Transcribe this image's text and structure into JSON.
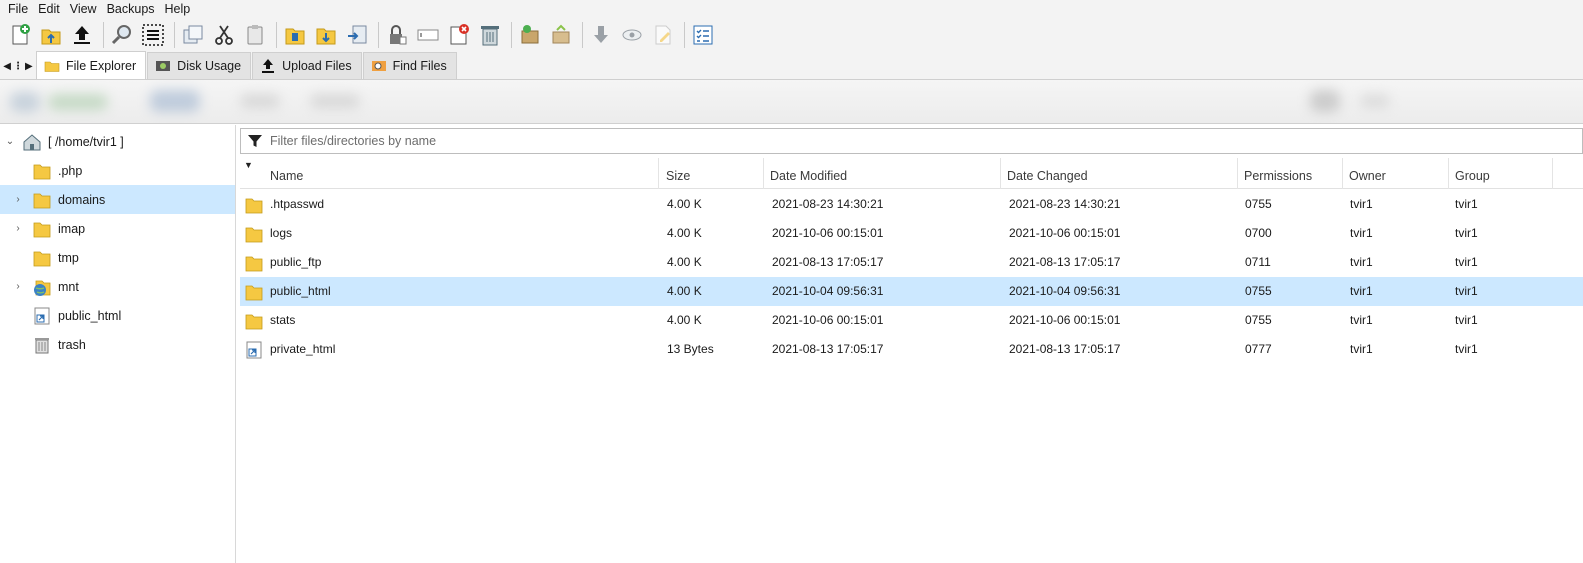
{
  "menu": [
    "File",
    "Edit",
    "View",
    "Backups",
    "Help"
  ],
  "toolbar": {
    "buttons": [
      "new-file-icon",
      "upload-folder-icon",
      "upload-icon",
      "search-icon",
      "select-all-icon",
      "copy-icon",
      "cut-icon",
      "paste-icon",
      "archive-icon",
      "extract-icon",
      "move-icon",
      "permissions-lock-icon",
      "rename-icon",
      "delete-file-icon",
      "trash-icon",
      "compress-icon",
      "decompress-icon",
      "download-icon",
      "view-icon",
      "edit-icon",
      "properties-icon"
    ]
  },
  "tabs": [
    {
      "label": "File Explorer",
      "icon": "folder-icon",
      "active": true
    },
    {
      "label": "Disk Usage",
      "icon": "disk-usage-icon",
      "active": false
    },
    {
      "label": "Upload Files",
      "icon": "upload-icon",
      "active": false
    },
    {
      "label": "Find Files",
      "icon": "find-files-icon",
      "active": false
    }
  ],
  "tree": {
    "root": "[ /home/tvir1 ]",
    "items": [
      {
        "label": ".php",
        "icon": "folder-icon",
        "expandable": false,
        "selected": false
      },
      {
        "label": "domains",
        "icon": "folder-icon",
        "expandable": true,
        "selected": true
      },
      {
        "label": "imap",
        "icon": "folder-icon",
        "expandable": true,
        "selected": false
      },
      {
        "label": "tmp",
        "icon": "folder-icon",
        "expandable": false,
        "selected": false
      },
      {
        "label": "mnt",
        "icon": "globe-folder-icon",
        "expandable": true,
        "selected": false
      },
      {
        "label": "public_html",
        "icon": "shortcut-icon",
        "expandable": false,
        "selected": false
      },
      {
        "label": "trash",
        "icon": "trash-icon",
        "expandable": false,
        "selected": false
      }
    ]
  },
  "filter": {
    "placeholder": "Filter files/directories by name"
  },
  "table": {
    "columns": [
      "Name",
      "Size",
      "Date Modified",
      "Date Changed",
      "Permissions",
      "Owner",
      "Group"
    ],
    "rows": [
      {
        "name": ".htpasswd",
        "icon": "folder-icon",
        "size": "4.00 K",
        "modified": "2021-08-23 14:30:21",
        "changed": "2021-08-23 14:30:21",
        "perm": "0755",
        "owner": "tvir1",
        "group": "tvir1",
        "selected": false
      },
      {
        "name": "logs",
        "icon": "folder-icon",
        "size": "4.00 K",
        "modified": "2021-10-06 00:15:01",
        "changed": "2021-10-06 00:15:01",
        "perm": "0700",
        "owner": "tvir1",
        "group": "tvir1",
        "selected": false
      },
      {
        "name": "public_ftp",
        "icon": "folder-icon",
        "size": "4.00 K",
        "modified": "2021-08-13 17:05:17",
        "changed": "2021-08-13 17:05:17",
        "perm": "0711",
        "owner": "tvir1",
        "group": "tvir1",
        "selected": false
      },
      {
        "name": "public_html",
        "icon": "folder-icon",
        "size": "4.00 K",
        "modified": "2021-10-04 09:56:31",
        "changed": "2021-10-04 09:56:31",
        "perm": "0755",
        "owner": "tvir1",
        "group": "tvir1",
        "selected": true
      },
      {
        "name": "stats",
        "icon": "folder-icon",
        "size": "4.00 K",
        "modified": "2021-10-06 00:15:01",
        "changed": "2021-10-06 00:15:01",
        "perm": "0755",
        "owner": "tvir1",
        "group": "tvir1",
        "selected": false
      },
      {
        "name": "private_html",
        "icon": "shortcut-icon",
        "size": "13 Bytes",
        "modified": "2021-08-13 17:05:17",
        "changed": "2021-08-13 17:05:17",
        "perm": "0777",
        "owner": "tvir1",
        "group": "tvir1",
        "selected": false
      }
    ]
  },
  "colors": {
    "selection": "#cce8ff",
    "folder": "#f5c842",
    "chrome": "#f3f3f3"
  }
}
